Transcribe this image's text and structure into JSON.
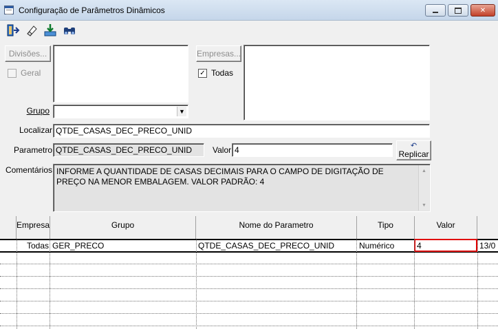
{
  "window": {
    "title": "Configuração de Parâmetros Dinâmicos",
    "minimize_icon": "minimize-icon",
    "maximize_icon": "maximize-icon",
    "close_icon": "close-icon"
  },
  "toolbar": {
    "icons": [
      "exit-icon",
      "eraser-icon",
      "save-download-icon",
      "binoculars-icon"
    ]
  },
  "filters": {
    "divisoes_button": "Divisões...",
    "geral_label": "Geral",
    "geral_checked": false,
    "empresas_button": "Empresas...",
    "todas_label": "Todas",
    "todas_checked": true,
    "check_mark": "✓",
    "grupo_label": "Grupo",
    "grupo_value": "",
    "localizar_label": "Localizar",
    "localizar_value": "QTDE_CASAS_DEC_PRECO_UNID",
    "parametro_label": "Parametro",
    "parametro_value": "QTDE_CASAS_DEC_PRECO_UNID",
    "valor_label": "Valor",
    "valor_value": "4",
    "replicar_button": "Replicar",
    "comentarios_label": "Comentários",
    "comentarios_text": "INFORME A QUANTIDADE DE CASAS DECIMAIS PARA O CAMPO DE DIGITAÇÃO DE PREÇO NA MENOR EMBALAGEM. VALOR PADRÃO: 4"
  },
  "grid": {
    "columns": [
      "Empresa",
      "Grupo",
      "Nome do Parametro",
      "Tipo",
      "Valor"
    ],
    "rows": [
      {
        "empresa": "Todas",
        "grupo": "GER_PRECO",
        "nome": "QTDE_CASAS_DEC_PRECO_UNID",
        "tipo": "Numérico",
        "valor": "4",
        "extra": "13/0"
      }
    ]
  },
  "colors": {
    "selected_cell_border": "#e00000",
    "window_bg": "#f0f0f0"
  }
}
